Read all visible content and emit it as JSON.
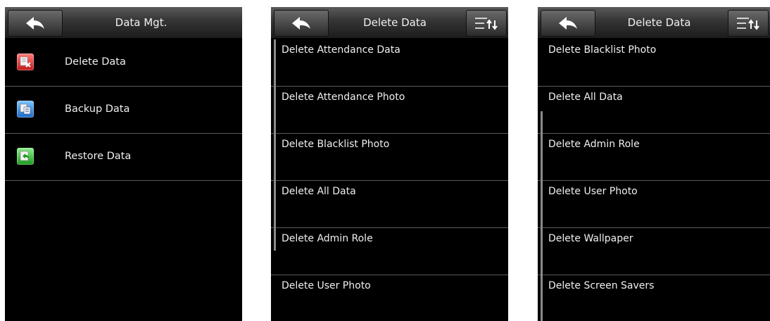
{
  "screens": [
    {
      "title": "Data Mgt.",
      "items": [
        {
          "label": "Delete Data",
          "icon": "delete-data-icon"
        },
        {
          "label": "Backup Data",
          "icon": "backup-data-icon"
        },
        {
          "label": "Restore Data",
          "icon": "restore-data-icon"
        }
      ]
    },
    {
      "title": "Delete Data",
      "items": [
        {
          "label": "Delete Attendance Data"
        },
        {
          "label": "Delete Attendance Photo"
        },
        {
          "label": "Delete Blacklist Photo"
        },
        {
          "label": "Delete All Data"
        },
        {
          "label": "Delete Admin Role"
        },
        {
          "label": "Delete User Photo"
        }
      ]
    },
    {
      "title": "Delete Data",
      "items": [
        {
          "label": "Delete Blacklist Photo"
        },
        {
          "label": "Delete All Data"
        },
        {
          "label": "Delete Admin Role"
        },
        {
          "label": "Delete User Photo"
        },
        {
          "label": "Delete Wallpaper"
        },
        {
          "label": "Delete Screen Savers"
        }
      ]
    }
  ],
  "icons": {
    "back": "back-arrow-icon",
    "sort": "sort-icon"
  },
  "colors": {
    "background": "#000000",
    "text": "#f0f0f0",
    "divider": "#5a5a5a"
  }
}
